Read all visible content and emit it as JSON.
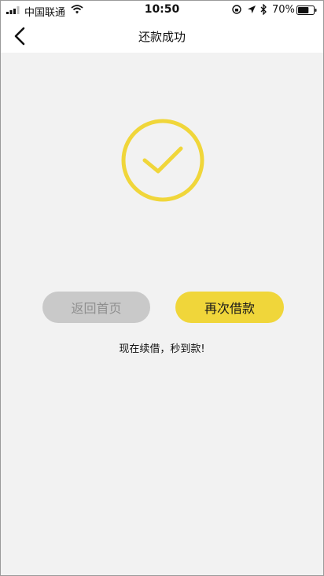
{
  "status_bar": {
    "carrier": "中国联通",
    "time": "10:50",
    "battery_percent": "70%",
    "battery_level": 0.7
  },
  "nav": {
    "title": "还款成功"
  },
  "success": {
    "icon": "check-circle-icon",
    "color": "#f0d63a"
  },
  "actions": {
    "home_label": "返回首页",
    "borrow_label": "再次借款"
  },
  "promo_text": "现在续借，秒到款!",
  "colors": {
    "accent": "#f0d63a",
    "disabled_bg": "#c9c9c9",
    "disabled_text": "#8f8f8f",
    "background": "#f2f2f2"
  }
}
